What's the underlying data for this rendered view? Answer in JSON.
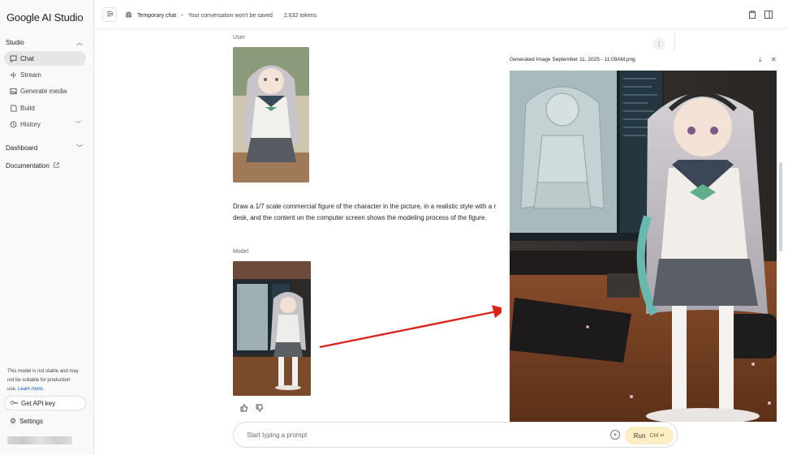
{
  "sidebar": {
    "brand": "Google AI Studio",
    "studio_label": "Studio",
    "items": [
      {
        "label": "Chat",
        "icon": "chat-bubble-icon"
      },
      {
        "label": "Stream",
        "icon": "stream-icon"
      },
      {
        "label": "Generate media",
        "icon": "media-icon"
      },
      {
        "label": "Build",
        "icon": "build-icon"
      },
      {
        "label": "History",
        "icon": "history-icon"
      }
    ],
    "dashboard_label": "Dashboard",
    "documentation_label": "Documentation",
    "warning_text": "This model is not stable and may not be suitable for production use.",
    "warning_link": "Learn more.",
    "api_key_label": "Get API key",
    "settings_label": "Settings"
  },
  "topbar": {
    "chat_title": "Temporary chat",
    "not_saved": "Your conversation won't be saved",
    "tokens": "2,632 tokens"
  },
  "chat": {
    "user_label": "User",
    "prompt": "Draw a 1/7 scale commercial figure of the character in the picture, in a realistic style with a r desk, and the content on the computer screen shows the modeling process of the figure.",
    "model_label": "Model"
  },
  "viewer": {
    "title": "Generated Image September 11, 2025 - 11:09AM.png"
  },
  "input": {
    "placeholder": "Start typing a prompt",
    "run_label": "Run",
    "shortcut": "Ctrl ↵"
  },
  "colors": {
    "accent_run": "#fbeec4",
    "active_nav": "#e4e6e8",
    "arrow": "#d9241c",
    "link": "#0b57d0"
  }
}
